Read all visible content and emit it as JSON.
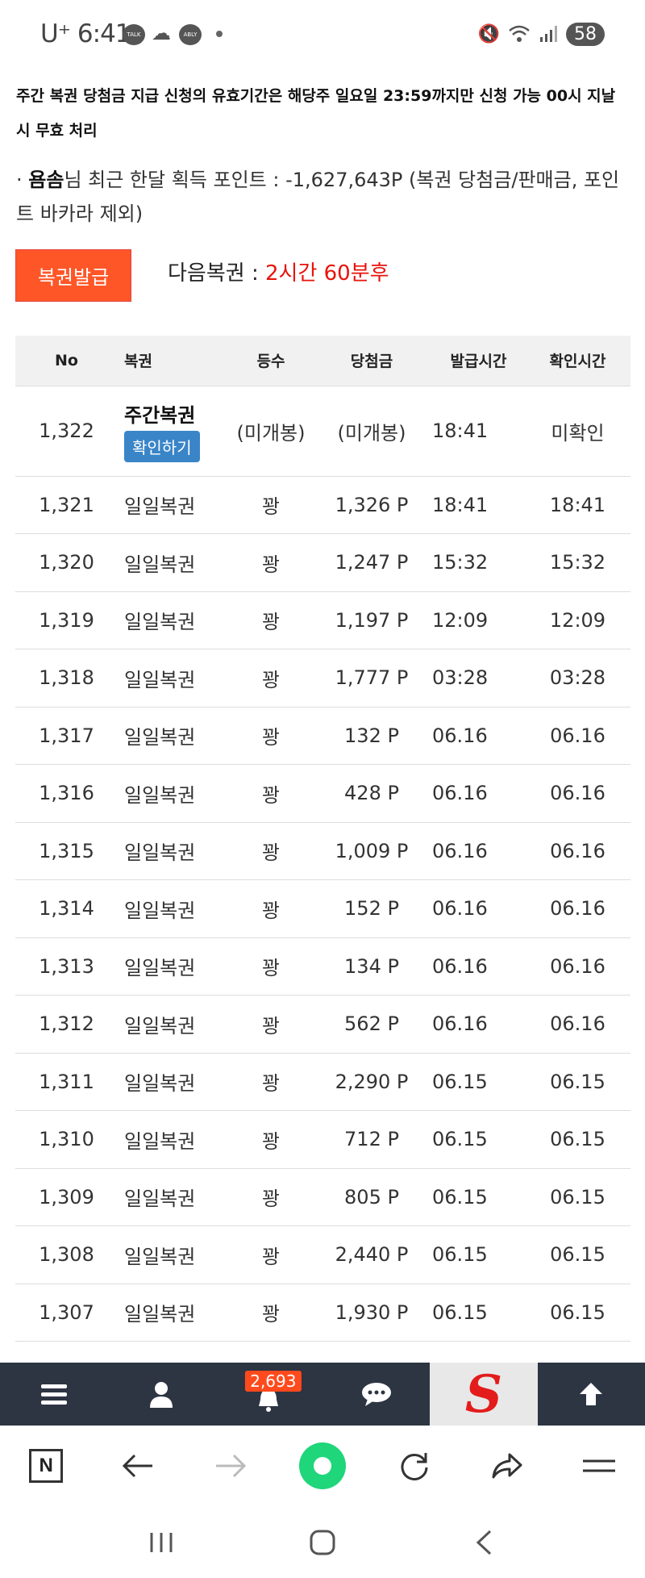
{
  "status_bar": {
    "carrier": "U⁺ 6:41",
    "icon1": "TALK",
    "icon2": "ABLY",
    "battery": "58"
  },
  "notice": "주간 복권 당첨금 지급 신청의 유효기간은 해당주 일요일 23:59까지만 신청 가능 00시 지날시 무효 처리",
  "points": {
    "prefix": "· ",
    "user": "욤솜",
    "text": "님 최근 한달 획득 포인트 : -1,627,643P (복권 당첨금/판매금, 포인트 바카라 제외)"
  },
  "issue_button": "복권발급",
  "next_lottery": {
    "label": "다음복권 : ",
    "value": "2시간 60분후"
  },
  "table": {
    "headers": [
      "No",
      "복권",
      "등수",
      "당첨금",
      "발급시간",
      "확인시간"
    ],
    "first_row": {
      "no": "1,322",
      "kind": "주간복권",
      "confirm_label": "확인하기",
      "rank": "(미개봉)",
      "prize": "(미개봉)",
      "issued": "18:41",
      "checked": "미확인"
    },
    "rows": [
      {
        "no": "1,321",
        "kind": "일일복권",
        "rank": "꽝",
        "prize": "1,326 P",
        "issued": "18:41",
        "checked": "18:41"
      },
      {
        "no": "1,320",
        "kind": "일일복권",
        "rank": "꽝",
        "prize": "1,247 P",
        "issued": "15:32",
        "checked": "15:32"
      },
      {
        "no": "1,319",
        "kind": "일일복권",
        "rank": "꽝",
        "prize": "1,197 P",
        "issued": "12:09",
        "checked": "12:09"
      },
      {
        "no": "1,318",
        "kind": "일일복권",
        "rank": "꽝",
        "prize": "1,777 P",
        "issued": "03:28",
        "checked": "03:28"
      },
      {
        "no": "1,317",
        "kind": "일일복권",
        "rank": "꽝",
        "prize": "132 P",
        "issued": "06.16",
        "checked": "06.16"
      },
      {
        "no": "1,316",
        "kind": "일일복권",
        "rank": "꽝",
        "prize": "428 P",
        "issued": "06.16",
        "checked": "06.16"
      },
      {
        "no": "1,315",
        "kind": "일일복권",
        "rank": "꽝",
        "prize": "1,009 P",
        "issued": "06.16",
        "checked": "06.16"
      },
      {
        "no": "1,314",
        "kind": "일일복권",
        "rank": "꽝",
        "prize": "152 P",
        "issued": "06.16",
        "checked": "06.16"
      },
      {
        "no": "1,313",
        "kind": "일일복권",
        "rank": "꽝",
        "prize": "134 P",
        "issued": "06.16",
        "checked": "06.16"
      },
      {
        "no": "1,312",
        "kind": "일일복권",
        "rank": "꽝",
        "prize": "562 P",
        "issued": "06.16",
        "checked": "06.16"
      },
      {
        "no": "1,311",
        "kind": "일일복권",
        "rank": "꽝",
        "prize": "2,290 P",
        "issued": "06.15",
        "checked": "06.15"
      },
      {
        "no": "1,310",
        "kind": "일일복권",
        "rank": "꽝",
        "prize": "712 P",
        "issued": "06.15",
        "checked": "06.15"
      },
      {
        "no": "1,309",
        "kind": "일일복권",
        "rank": "꽝",
        "prize": "805 P",
        "issued": "06.15",
        "checked": "06.15"
      },
      {
        "no": "1,308",
        "kind": "일일복권",
        "rank": "꽝",
        "prize": "2,440 P",
        "issued": "06.15",
        "checked": "06.15"
      },
      {
        "no": "1,307",
        "kind": "일일복권",
        "rank": "꽝",
        "prize": "1,930 P",
        "issued": "06.15",
        "checked": "06.15"
      }
    ]
  },
  "bottom_bar": {
    "notification_count": "2,693",
    "icons": [
      "menu-icon",
      "user-icon",
      "bell-icon",
      "chat-icon",
      "site-logo",
      "arrow-up-icon"
    ],
    "logo_letter": "S"
  },
  "browser_bar": {
    "n_label": "N",
    "icons": [
      "n-home-icon",
      "back-arrow-icon",
      "forward-arrow-icon",
      "green-circle-icon",
      "refresh-icon",
      "share-icon",
      "browser-menu-icon"
    ]
  },
  "colors": {
    "accent_orange": "#ff5627",
    "red_text": "#e8130a",
    "yellow_status": "#e8a21a",
    "blue_button": "#3a85c8",
    "bottom_bar_bg": "#2d3442",
    "green": "#1fd67a"
  }
}
